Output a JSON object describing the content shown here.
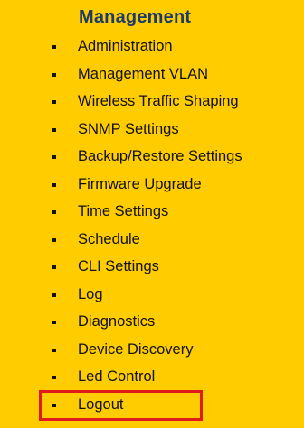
{
  "section": {
    "title": "Management"
  },
  "menu": {
    "items": [
      {
        "label": "Administration",
        "name": "administration"
      },
      {
        "label": "Management VLAN",
        "name": "management-vlan"
      },
      {
        "label": "Wireless Traffic Shaping",
        "name": "wireless-traffic-shaping"
      },
      {
        "label": "SNMP Settings",
        "name": "snmp-settings"
      },
      {
        "label": "Backup/Restore Settings",
        "name": "backup-restore-settings"
      },
      {
        "label": "Firmware Upgrade",
        "name": "firmware-upgrade"
      },
      {
        "label": "Time Settings",
        "name": "time-settings"
      },
      {
        "label": "Schedule",
        "name": "schedule"
      },
      {
        "label": "CLI Settings",
        "name": "cli-settings"
      },
      {
        "label": "Log",
        "name": "log"
      },
      {
        "label": "Diagnostics",
        "name": "diagnostics"
      },
      {
        "label": "Device Discovery",
        "name": "device-discovery"
      },
      {
        "label": "Led Control",
        "name": "led-control"
      },
      {
        "label": "Logout",
        "name": "logout"
      }
    ]
  },
  "colors": {
    "background": "#ffcc00",
    "title": "#1c3a6b",
    "text": "#111111",
    "highlight": "#e01b1b"
  }
}
